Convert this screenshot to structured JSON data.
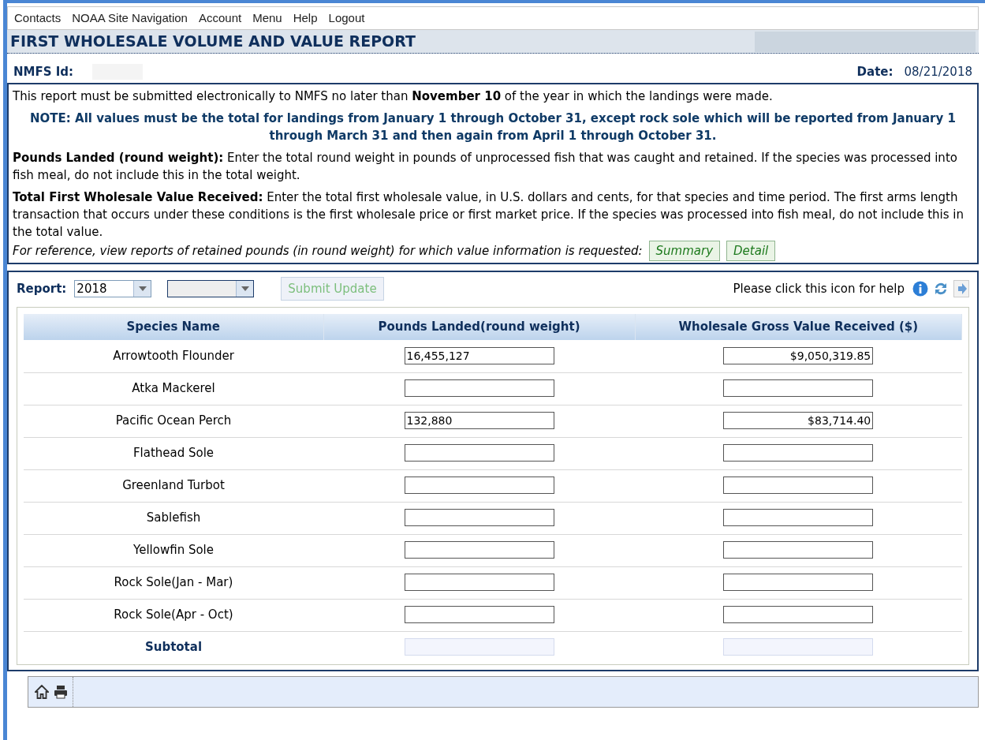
{
  "menu": [
    "Contacts",
    "NOAA Site Navigation",
    "Account",
    "Menu",
    "Help",
    "Logout"
  ],
  "title": "FIRST WHOLESALE VOLUME AND VALUE REPORT",
  "nmfs_id": {
    "label": "NMFS Id:"
  },
  "date": {
    "label": "Date:",
    "value": "08/21/2018"
  },
  "instructions": {
    "deadline": "This report must be submitted electronically to NMFS no later than **November 10** of the year in which the landings were made.",
    "note": "NOTE: All values must be the total for landings from January 1 through October 31, except rock sole which will be reported from January 1 through March 31 and then again from April 1 through October 31.",
    "pounds": "**Pounds Landed (round weight):** Enter the total round weight in pounds of unprocessed fish that was caught and retained. If the species was processed into fish meal, do not include this in the total weight.",
    "value": "**Total First Wholesale Value Received:** Enter the total first wholesale value, in U.S. dollars and cents, for that species and time period. The first arms length transaction that occurs under these conditions is the first wholesale price or first market price. If the species was processed into fish meal, do not include this in the total value.",
    "reference": "For reference, view reports of retained pounds (in round weight) for which value information is requested:",
    "buttons": [
      "Summary",
      "Detail"
    ]
  },
  "report": {
    "label": "Report:",
    "year": "2018",
    "submit": {
      "label": "Submit Update",
      "disabled": true
    },
    "help_text": "Please click this icon for help"
  },
  "table": {
    "columns": [
      "Species Name",
      "Pounds Landed(round weight)",
      "Wholesale Gross Value Received ($)"
    ],
    "rows": [
      {
        "species": "Arrowtooth Flounder",
        "pounds": "16,455,127",
        "value": "$9,050,319.85"
      },
      {
        "species": "Atka Mackerel",
        "pounds": "",
        "value": ""
      },
      {
        "species": "Pacific Ocean Perch",
        "pounds": "132,880",
        "value": "$83,714.40"
      },
      {
        "species": "Flathead Sole",
        "pounds": "",
        "value": ""
      },
      {
        "species": "Greenland Turbot",
        "pounds": "",
        "value": ""
      },
      {
        "species": "Sablefish",
        "pounds": "",
        "value": ""
      },
      {
        "species": "Yellowfin Sole",
        "pounds": "",
        "value": ""
      },
      {
        "species": "Rock Sole(Jan - Mar)",
        "pounds": "",
        "value": ""
      },
      {
        "species": "Rock Sole(Apr - Oct)",
        "pounds": "",
        "value": ""
      }
    ],
    "subtotal": {
      "label": "Subtotal",
      "disabled": true
    }
  }
}
